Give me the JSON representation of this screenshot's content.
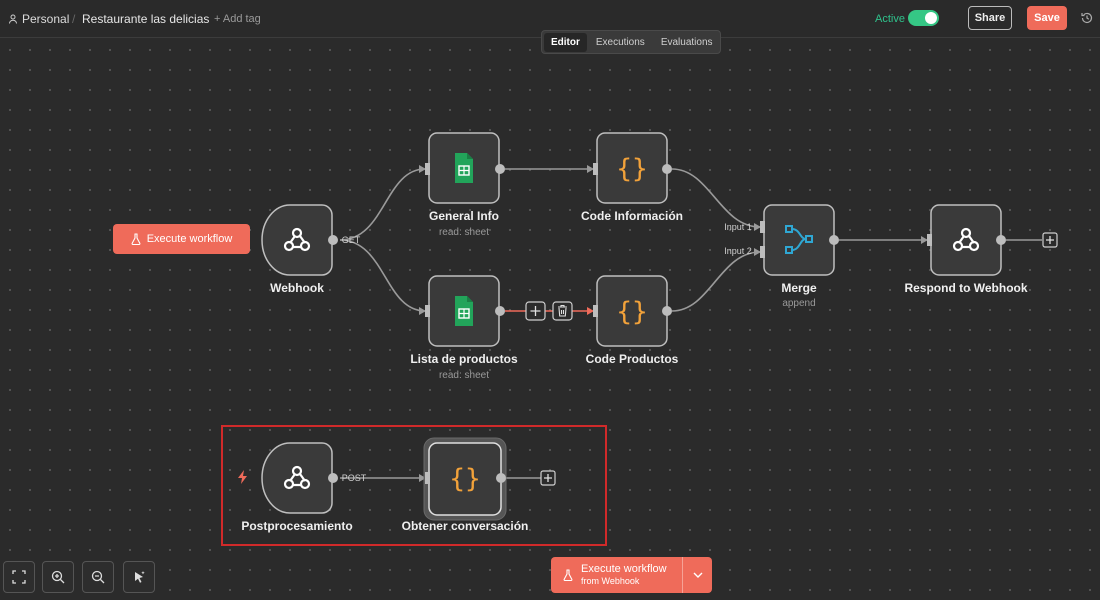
{
  "topbar": {
    "workspace": "Personal",
    "workflow_name": "Restaurante las delicias",
    "add_tag": "+ Add tag",
    "active_label": "Active",
    "share_label": "Share",
    "save_label": "Save"
  },
  "tabs": [
    "Editor",
    "Executions",
    "Evaluations"
  ],
  "execute_left_label": "Execute workflow",
  "nodes": {
    "webhook": {
      "title": "Webhook"
    },
    "general_info": {
      "title": "General Info",
      "subtitle": "read: sheet"
    },
    "lista_productos": {
      "title": "Lista de productos",
      "subtitle": "read: sheet"
    },
    "code_info": {
      "title": "Code Información"
    },
    "code_productos": {
      "title": "Code Productos"
    },
    "merge": {
      "title": "Merge",
      "subtitle": "append",
      "input1": "Input 1",
      "input2": "Input 2"
    },
    "respond": {
      "title": "Respond to Webhook"
    },
    "postprocesamiento": {
      "title": "Postprocesamiento"
    },
    "obtener": {
      "title": "Obtener conversación"
    }
  },
  "edge_labels": {
    "get": "GET",
    "post": "POST"
  },
  "execute_bottom": {
    "line1": "Execute workflow",
    "line2": "from Webhook"
  },
  "icons": [
    "person-icon",
    "flask-icon",
    "webhook-icon",
    "google-sheets-icon",
    "code-braces-icon",
    "merge-icon",
    "plus-icon",
    "trash-icon",
    "bolt-icon",
    "fit-view-icon",
    "zoom-in-icon",
    "zoom-out-icon",
    "cursor-icon",
    "chevron-down-icon",
    "history-icon"
  ],
  "colors": {
    "accent": "#ef6b5a",
    "active": "#35c785",
    "sheets": "#22a45a",
    "code": "#f2a23a",
    "merge": "#2fa7d3"
  }
}
